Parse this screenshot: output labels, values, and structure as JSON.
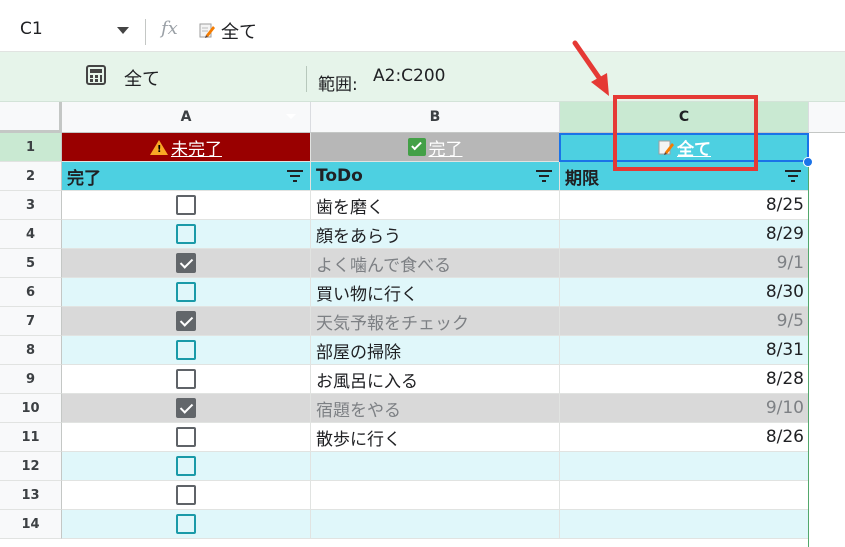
{
  "formula_bar": {
    "cell_ref": "C1",
    "fx_label": "fx",
    "value": "全て"
  },
  "filter_view": {
    "name": "全て",
    "range_label": "範囲:",
    "range_value": "A2:C200"
  },
  "columns": [
    "A",
    "B",
    "C"
  ],
  "filter_buttons": {
    "a": "未完了",
    "b": "完了",
    "c": "全て"
  },
  "headers": {
    "done": "完了",
    "todo": "ToDo",
    "due": "期限"
  },
  "rows": [
    {
      "num": "1"
    },
    {
      "num": "2"
    },
    {
      "num": "3",
      "checked": false,
      "todo": "歯を磨く",
      "due": "8/25"
    },
    {
      "num": "4",
      "checked": false,
      "todo": "顔をあらう",
      "due": "8/29"
    },
    {
      "num": "5",
      "checked": true,
      "todo": "よく噛んで食べる",
      "due": "9/1"
    },
    {
      "num": "6",
      "checked": false,
      "todo": "買い物に行く",
      "due": "8/30"
    },
    {
      "num": "7",
      "checked": true,
      "todo": "天気予報をチェック",
      "due": "9/5"
    },
    {
      "num": "8",
      "checked": false,
      "todo": "部屋の掃除",
      "due": "8/31"
    },
    {
      "num": "9",
      "checked": false,
      "todo": "お風呂に入る",
      "due": "8/28"
    },
    {
      "num": "10",
      "checked": true,
      "todo": "宿題をやる",
      "due": "9/10"
    },
    {
      "num": "11",
      "checked": false,
      "todo": "散歩に行く",
      "due": "8/26"
    },
    {
      "num": "12",
      "checked": false
    },
    {
      "num": "13",
      "checked": false
    },
    {
      "num": "14",
      "checked": false
    }
  ],
  "colors": {
    "incomplete_btn": "#990000",
    "complete_btn": "#b7b7b7",
    "all_btn": "#4dd0e1",
    "header_bg": "#4dd0e1",
    "band_light": "#e0f7fa",
    "done_row": "#d9d9d9",
    "highlight": "#e53935"
  }
}
